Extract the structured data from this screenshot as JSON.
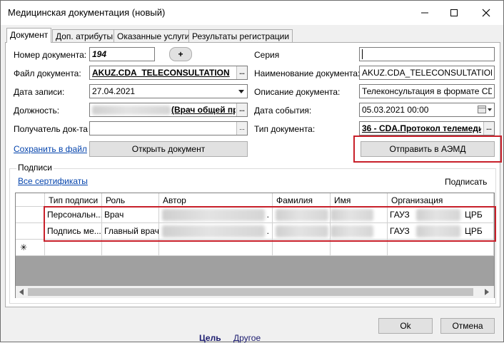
{
  "window": {
    "title": "Медицинская документация (новый)"
  },
  "tabs": [
    {
      "label": "Документ"
    },
    {
      "label": "Доп. атрибуты"
    },
    {
      "label": "Оказанные услуги"
    },
    {
      "label": "Результаты регистрации"
    }
  ],
  "form": {
    "doc_number_label": "Номер документа:",
    "doc_number_value": "194",
    "add_label": "+",
    "series_label": "Серия",
    "series_value": "",
    "file_label": "Файл документа:",
    "file_value": "AKUZ.CDA_TELECONSULTATION",
    "doc_name_label": "Наименование документа:",
    "doc_name_value": "AKUZ.CDA_TELECONSULTATION",
    "record_date_label": "Дата записи:",
    "record_date_value": "27.04.2021",
    "doc_desc_label": "Описание документа:",
    "doc_desc_value": "Телеконсультация в формате CDA",
    "position_label": "Должность:",
    "position_value": "(Врач общей пр",
    "event_date_label": "Дата события:",
    "event_date_value": "05.03.2021 00:00",
    "recipient_label": "Получатель док-та",
    "recipient_value": "",
    "doc_type_label": "Тип документа:",
    "doc_type_value": "36 - CDA.Протокол телемеди",
    "ellipsis": "...",
    "save_to_file_link": "Сохранить в файл",
    "open_doc_button": "Открыть документ",
    "send_aemd_button": "Отправить в АЭМД"
  },
  "signatures": {
    "group_label": "Подписи",
    "all_certs_link": "Все сертификаты",
    "sign_button": "Подписать",
    "columns": [
      "Тип подписи",
      "Роль",
      "Автор",
      "Фамилия",
      "Имя",
      "Организация"
    ],
    "rows": [
      {
        "type": "Персональн...",
        "role": "Врач",
        "author": "",
        "author_tail": ".",
        "surname": "",
        "name": "",
        "org_prefix": "ГАУЗ",
        "org_suffix": "ЦРБ"
      },
      {
        "type": "Подпись ме...",
        "role": "Главный врач",
        "author": "",
        "author_tail": ".",
        "surname": "",
        "name": "",
        "org_prefix": "ГАУЗ",
        "org_suffix": "ЦРБ"
      }
    ],
    "new_row_marker": "✳"
  },
  "footer": {
    "ok_button": "Ok",
    "cancel_button": "Отмена"
  },
  "background": {
    "text1": "Цель",
    "text2": "Другое"
  },
  "colors": {
    "highlight": "#c8202a",
    "link": "#0645ad"
  }
}
